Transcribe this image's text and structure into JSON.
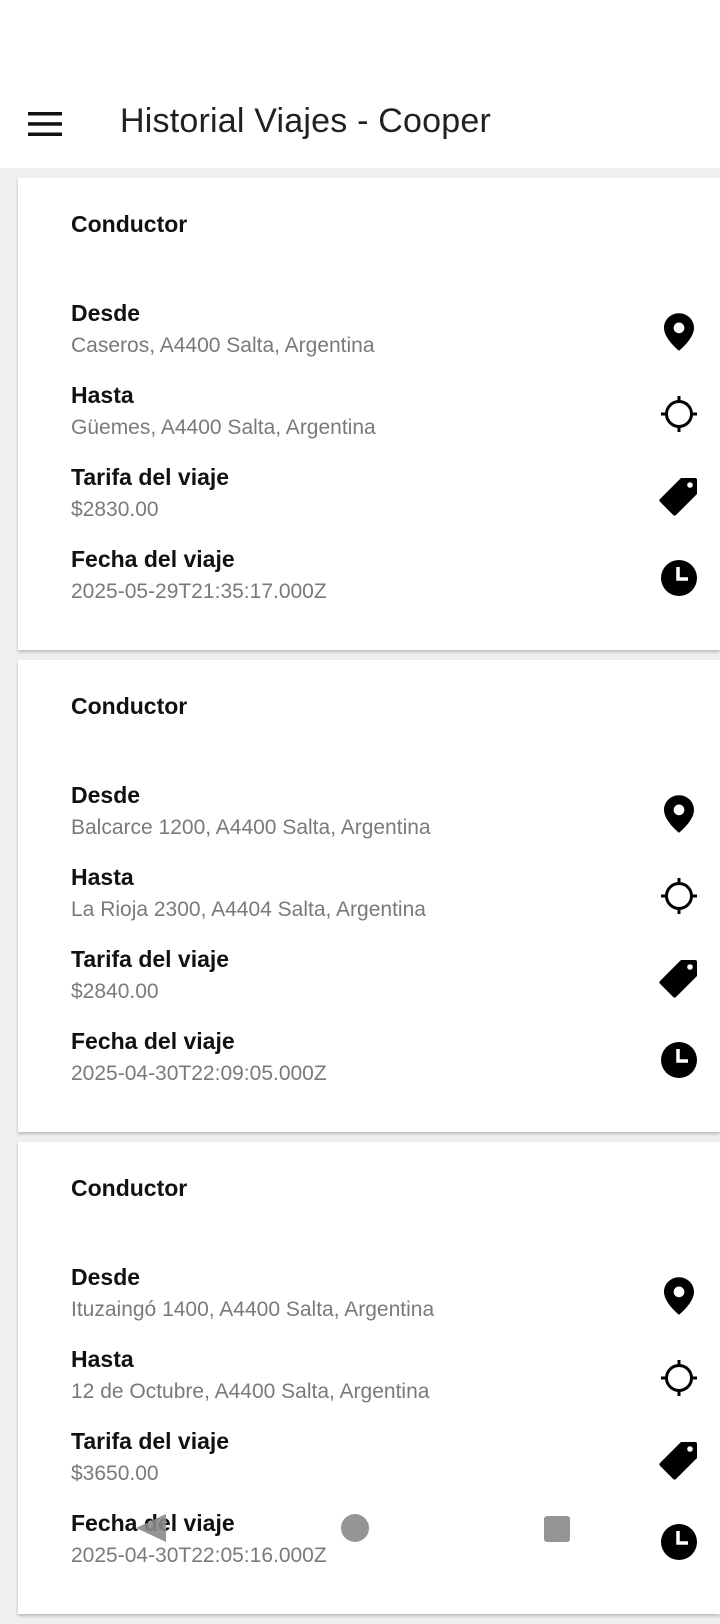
{
  "app_bar": {
    "title": "Historial Viajes - Cooper",
    "menu_icon": "menu-icon"
  },
  "trips": [
    {
      "driver_label": "Conductor",
      "from_label": "Desde",
      "from_value": "Caseros, A4400 Salta, Argentina",
      "to_label": "Hasta",
      "to_value": "Güemes, A4400 Salta, Argentina",
      "fare_label": "Tarifa del viaje",
      "fare_value": "$2830.00",
      "date_label": "Fecha del viaje",
      "date_value": "2025-05-29T21:35:17.000Z"
    },
    {
      "driver_label": "Conductor",
      "from_label": "Desde",
      "from_value": "Balcarce 1200, A4400 Salta, Argentina",
      "to_label": "Hasta",
      "to_value": "La Rioja 2300, A4404 Salta, Argentina",
      "fare_label": "Tarifa del viaje",
      "fare_value": "$2840.00",
      "date_label": "Fecha del viaje",
      "date_value": "2025-04-30T22:09:05.000Z"
    },
    {
      "driver_label": "Conductor",
      "from_label": "Desde",
      "from_value": "Ituzaingó 1400, A4400 Salta, Argentina",
      "to_label": "Hasta",
      "to_value": "12 de Octubre, A4400 Salta, Argentina",
      "fare_label": "Tarifa del viaje",
      "fare_value": "$3650.00",
      "date_label": "Fecha del viaje",
      "date_value": "2025-04-30T22:05:16.000Z"
    }
  ],
  "icons": {
    "from": "map-pin-icon",
    "to": "crosshair-icon",
    "fare": "price-tag-icon",
    "date": "clock-icon"
  },
  "nav_bar": {
    "back": "back-icon",
    "home": "home-icon",
    "recents": "recents-icon"
  },
  "colors": {
    "background": "#efefef",
    "card": "#ffffff",
    "text_primary": "#111111",
    "text_secondary": "#7a7a7a"
  }
}
